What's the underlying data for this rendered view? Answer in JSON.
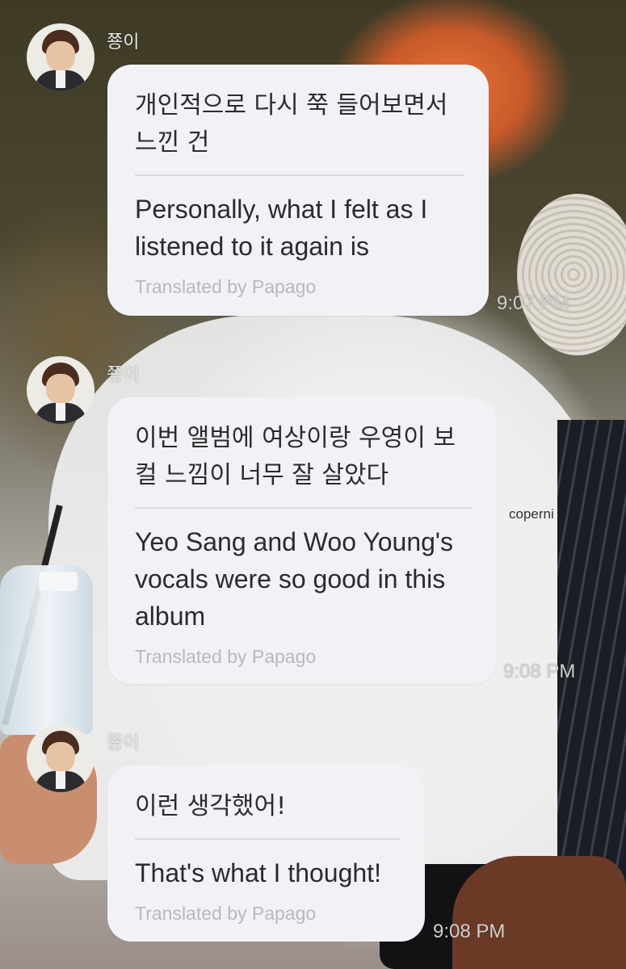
{
  "messages": [
    {
      "sender": "쭁이",
      "original": "개인적으로 다시 쭉 들어보면서 느낀 건",
      "translation": "Personally, what I felt as I listened to it again is",
      "credit": "Translated by Papago",
      "time": "9:07 PM"
    },
    {
      "sender": "쭁이",
      "original": "이번 앨범에 여상이랑 우영이 보컬 느낌이 너무 잘 살았다",
      "translation": "Yeo Sang and Woo Young's vocals were so good in this album",
      "credit": "Translated by Papago",
      "time": "9:08 PM"
    },
    {
      "sender": "쭁이",
      "original": "이런 생각했어!",
      "translation": "That's what I thought!",
      "credit": "Translated by Papago",
      "time": "9:08 PM"
    }
  ],
  "background": {
    "shirt_text": "coperni"
  }
}
